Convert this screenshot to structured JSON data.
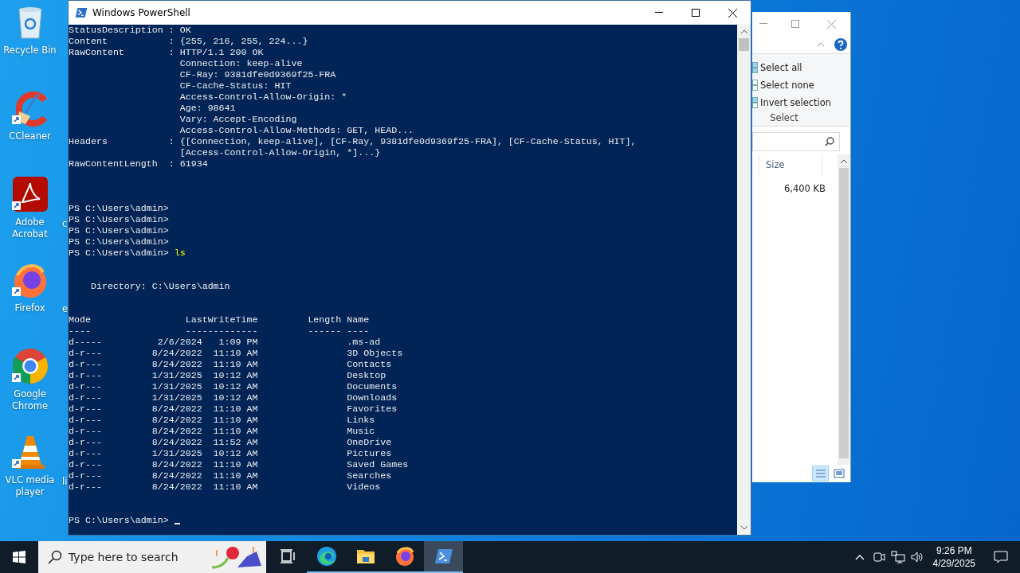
{
  "desktop_icons": [
    {
      "label": "Recycle Bin",
      "kind": "recycle"
    },
    {
      "label": "CCleaner",
      "kind": "ccleaner"
    },
    {
      "label": "Adobe Acrobat",
      "kind": "acrobat"
    },
    {
      "label": "Firefox",
      "kind": "firefox"
    },
    {
      "label": "Google Chrome",
      "kind": "chrome"
    },
    {
      "label": "VLC media player",
      "kind": "vlc"
    }
  ],
  "desktop_partial_labels": [
    "c",
    "e",
    "li"
  ],
  "explorer": {
    "ribbon_items": [
      "Select all",
      "Select none",
      "Invert selection"
    ],
    "ribbon_group": "Select",
    "column": "Size",
    "size_value": "6,400 KB",
    "views": [
      {
        "kind": "details",
        "selected": true
      },
      {
        "kind": "large",
        "selected": false
      }
    ]
  },
  "powershell": {
    "title": "Windows PowerShell",
    "lines": [
      {
        "kind": "text",
        "text": "StatusDescription : OK"
      },
      {
        "kind": "text",
        "text": "Content           : {255, 216, 255, 224...}"
      },
      {
        "kind": "text",
        "text": "RawContent        : HTTP/1.1 200 OK"
      },
      {
        "kind": "text",
        "text": "                    Connection: keep-alive"
      },
      {
        "kind": "text",
        "text": "                    CF-Ray: 9381dfe0d9369f25-FRA"
      },
      {
        "kind": "text",
        "text": "                    CF-Cache-Status: HIT"
      },
      {
        "kind": "text",
        "text": "                    Access-Control-Allow-Origin: *"
      },
      {
        "kind": "text",
        "text": "                    Age: 98641"
      },
      {
        "kind": "text",
        "text": "                    Vary: Accept-Encoding"
      },
      {
        "kind": "text",
        "text": "                    Access-Control-Allow-Methods: GET, HEAD..."
      },
      {
        "kind": "text",
        "text": "Headers           : {[Connection, keep-alive], [CF-Ray, 9381dfe0d9369f25-FRA], [CF-Cache-Status, HIT],"
      },
      {
        "kind": "text",
        "text": "                    [Access-Control-Allow-Origin, *]...}"
      },
      {
        "kind": "text",
        "text": "RawContentLength  : 61934"
      },
      {
        "kind": "blank"
      },
      {
        "kind": "blank"
      },
      {
        "kind": "blank"
      },
      {
        "kind": "prompt",
        "text": "PS C:\\Users\\admin>"
      },
      {
        "kind": "prompt",
        "text": "PS C:\\Users\\admin>"
      },
      {
        "kind": "prompt",
        "text": "PS C:\\Users\\admin>"
      },
      {
        "kind": "prompt",
        "text": "PS C:\\Users\\admin>"
      },
      {
        "kind": "prompt",
        "text": "PS C:\\Users\\admin>",
        "command": "ls"
      },
      {
        "kind": "blank"
      },
      {
        "kind": "blank"
      },
      {
        "kind": "text",
        "text": "    Directory: C:\\Users\\admin"
      },
      {
        "kind": "blank"
      },
      {
        "kind": "blank"
      },
      {
        "kind": "text",
        "text": "Mode                 LastWriteTime         Length Name"
      },
      {
        "kind": "text",
        "text": "----                 -------------         ------ ----"
      },
      {
        "kind": "text",
        "text": "d-----          2/6/2024   1:09 PM                .ms-ad"
      },
      {
        "kind": "text",
        "text": "d-r---         8/24/2022  11:10 AM                3D Objects"
      },
      {
        "kind": "text",
        "text": "d-r---         8/24/2022  11:10 AM                Contacts"
      },
      {
        "kind": "text",
        "text": "d-r---         1/31/2025  10:12 AM                Desktop"
      },
      {
        "kind": "text",
        "text": "d-r---         1/31/2025  10:12 AM                Documents"
      },
      {
        "kind": "text",
        "text": "d-r---         1/31/2025  10:12 AM                Downloads"
      },
      {
        "kind": "text",
        "text": "d-r---         8/24/2022  11:10 AM                Favorites"
      },
      {
        "kind": "text",
        "text": "d-r---         8/24/2022  11:10 AM                Links"
      },
      {
        "kind": "text",
        "text": "d-r---         8/24/2022  11:10 AM                Music"
      },
      {
        "kind": "text",
        "text": "d-r---         8/24/2022  11:52 AM                OneDrive"
      },
      {
        "kind": "text",
        "text": "d-r---         1/31/2025  10:12 AM                Pictures"
      },
      {
        "kind": "text",
        "text": "d-r---         8/24/2022  11:10 AM                Saved Games"
      },
      {
        "kind": "text",
        "text": "d-r---         8/24/2022  11:10 AM                Searches"
      },
      {
        "kind": "text",
        "text": "d-r---         8/24/2022  11:10 AM                Videos"
      },
      {
        "kind": "blank"
      },
      {
        "kind": "blank"
      },
      {
        "kind": "prompt",
        "text": "PS C:\\Users\\admin>",
        "cursor": true
      }
    ]
  },
  "taskbar": {
    "search_placeholder": "Type here to search",
    "apps": [
      {
        "kind": "taskview",
        "running": false,
        "selected": false
      },
      {
        "kind": "edge",
        "running": true,
        "selected": false
      },
      {
        "kind": "explorer",
        "running": true,
        "selected": false
      },
      {
        "kind": "firefox",
        "running": true,
        "selected": false
      },
      {
        "kind": "powershell",
        "running": true,
        "selected": true
      }
    ],
    "time": "9:26 PM",
    "date": "4/29/2025"
  }
}
